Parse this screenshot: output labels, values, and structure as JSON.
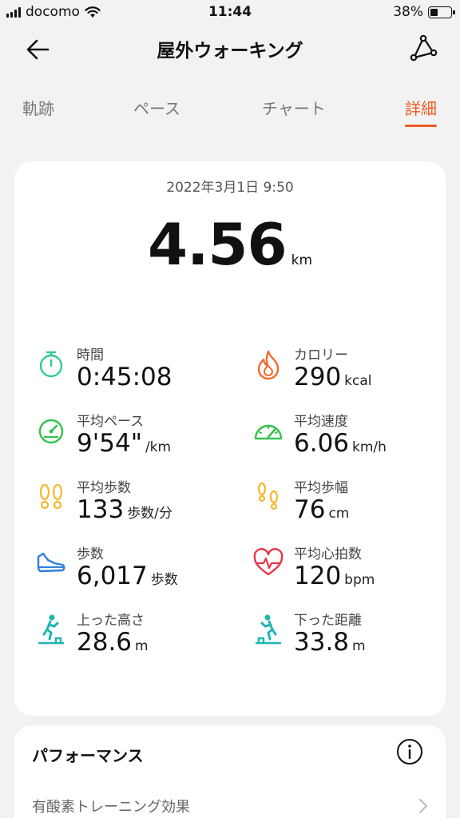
{
  "status_bar": {
    "carrier": "docomo",
    "time": "11:44",
    "battery": "38%",
    "battery_level": 0.38
  },
  "header": {
    "title": "屋外ウォーキング",
    "back_icon": "arrow-left-icon",
    "route_icon": "route-share-icon"
  },
  "tabs": [
    {
      "label": "軌跡",
      "active": false
    },
    {
      "label": "ペース",
      "active": false
    },
    {
      "label": "チャート",
      "active": false
    },
    {
      "label": "詳細",
      "active": true
    }
  ],
  "summary": {
    "date": "2022年3月1日 9:50",
    "distance": "4.56",
    "distance_unit": "km"
  },
  "metrics": [
    {
      "label": "時間",
      "value": "0:45:08",
      "unit": "",
      "icon": "stopwatch-icon",
      "color": "#2ecc8f"
    },
    {
      "label": "カロリー",
      "value": "290",
      "unit": "kcal",
      "icon": "flame-icon",
      "color": "#f26a2e"
    },
    {
      "label": "平均ペース",
      "value": "9'54\"",
      "unit": "/km",
      "icon": "speedometer-icon",
      "color": "#34c24a"
    },
    {
      "label": "平均速度",
      "value": "6.06",
      "unit": "km/h",
      "icon": "gauge-icon",
      "color": "#34c24a"
    },
    {
      "label": "平均歩数",
      "value": "133",
      "unit": "歩数/分",
      "icon": "footprints-icon",
      "color": "#f5b82e"
    },
    {
      "label": "平均歩幅",
      "value": "76",
      "unit": "cm",
      "icon": "footprints-stride-icon",
      "color": "#f5b82e"
    },
    {
      "label": "歩数",
      "value": "6,017",
      "unit": "歩数",
      "icon": "shoe-icon",
      "color": "#2f7de1"
    },
    {
      "label": "平均心拍数",
      "value": "120",
      "unit": "bpm",
      "icon": "heart-rate-icon",
      "color": "#e8344a"
    },
    {
      "label": "上った高さ",
      "value": "28.6",
      "unit": "m",
      "icon": "climb-up-icon",
      "color": "#1fb5b0"
    },
    {
      "label": "下った距離",
      "value": "33.8",
      "unit": "m",
      "icon": "climb-down-icon",
      "color": "#1fb5b0"
    }
  ],
  "performance": {
    "title": "パフォーマンス",
    "info_icon": "info-icon",
    "row_label": "有酸素トレーニング効果"
  },
  "colors": {
    "accent": "#ef5a1f",
    "background": "#f2f2f2",
    "card": "#ffffff"
  }
}
